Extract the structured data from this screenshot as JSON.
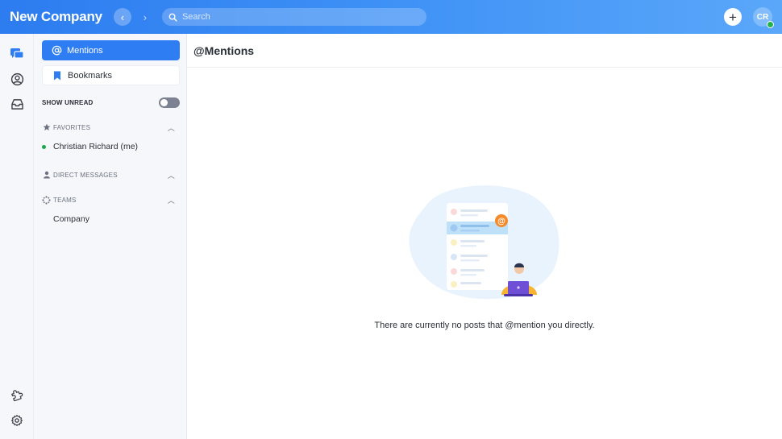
{
  "header": {
    "brand": "New Company",
    "back_label": "‹",
    "forward_label": "›",
    "search_placeholder": "Search",
    "add_label": "+",
    "avatar_initials": "CR",
    "accent": "#2e7df2"
  },
  "rail": {
    "icons": [
      "chat-bubbles-icon",
      "user-circle-icon",
      "inbox-icon",
      "puzzle-icon",
      "gear-icon"
    ]
  },
  "sidebar": {
    "mentions_label": "Mentions",
    "bookmarks_label": "Bookmarks",
    "show_unread_label": "SHOW UNREAD",
    "show_unread_on": false,
    "favorites_label": "FAVORITES",
    "favorites": [
      {
        "name": "Christian Richard (me)",
        "online": true
      }
    ],
    "direct_messages_label": "DIRECT MESSAGES",
    "teams_label": "TEAMS",
    "teams": [
      "Company"
    ]
  },
  "main": {
    "title": "@Mentions",
    "empty_message": "There are currently no posts that @mention you directly."
  }
}
